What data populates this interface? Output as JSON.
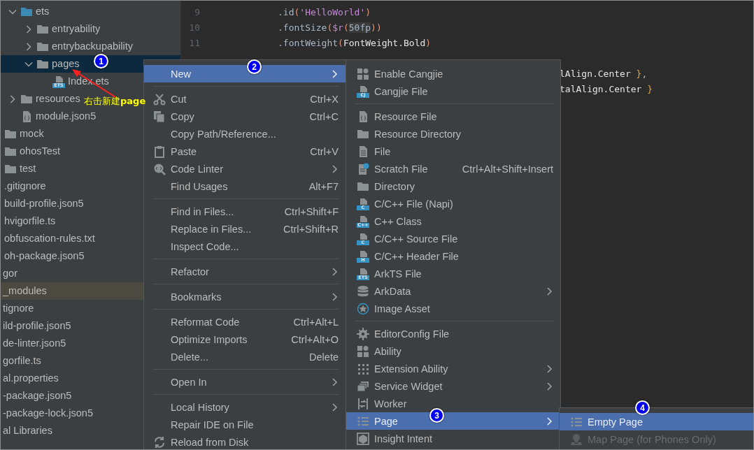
{
  "project_tree": [
    {
      "children": [
        {
          "children": [
            {
              "label": "ets",
              "kind": "source-folder",
              "expanded": true,
              "selected": false,
              "highlighted": false,
              "children": [
                {
                  "label": "entryability",
                  "kind": "folder",
                  "expanded": false,
                  "selected": false,
                  "highlighted": false
                },
                {
                  "label": "entrybackupability",
                  "kind": "folder",
                  "expanded": false,
                  "selected": false,
                  "highlighted": false
                },
                {
                  "label": "pages",
                  "kind": "folder",
                  "expanded": true,
                  "selected": true,
                  "highlighted": false,
                  "children": [
                    {
                      "label": "Index.ets",
                      "kind": "ets-file",
                      "badge": "ETS",
                      "selected": false,
                      "highlighted": false
                    }
                  ]
                }
              ]
            },
            {
              "label": "resources",
              "kind": "folder",
              "expanded": false,
              "selected": false,
              "highlighted": false
            },
            {
              "label": "module.json5",
              "kind": "json-file",
              "selected": false,
              "highlighted": false
            }
          ]
        },
        {
          "label": "mock",
          "kind": "folder",
          "selected": false,
          "highlighted": false
        },
        {
          "label": "ohosTest",
          "kind": "folder",
          "selected": false,
          "highlighted": false
        },
        {
          "label": "test",
          "kind": "folder",
          "selected": false,
          "highlighted": false
        },
        {
          "label": ".gitignore",
          "kind": "plain",
          "selected": false,
          "highlighted": false
        },
        {
          "label": "build-profile.json5",
          "kind": "plain",
          "selected": false,
          "highlighted": false
        },
        {
          "label": "hvigorfile.ts",
          "kind": "plain",
          "selected": false,
          "highlighted": false
        },
        {
          "label": "obfuscation-rules.txt",
          "kind": "plain",
          "selected": false,
          "highlighted": false
        },
        {
          "label": "oh-package.json5",
          "kind": "plain",
          "selected": false,
          "highlighted": false
        }
      ]
    },
    {
      "label": "gor",
      "kind": "plain",
      "selected": false,
      "highlighted": false
    },
    {
      "label": "_modules",
      "kind": "plain",
      "selected": false,
      "highlighted": true
    },
    {
      "label": "tignore",
      "kind": "plain",
      "selected": false,
      "highlighted": false
    },
    {
      "label": "ild-profile.json5",
      "kind": "plain",
      "selected": false,
      "highlighted": false
    },
    {
      "label": "de-linter.json5",
      "kind": "plain",
      "selected": false,
      "highlighted": false
    },
    {
      "label": "gorfile.ts",
      "kind": "plain",
      "selected": false,
      "highlighted": false
    },
    {
      "label": "al.properties",
      "kind": "plain",
      "selected": false,
      "highlighted": false
    },
    {
      "label": "-package.json5",
      "kind": "plain",
      "selected": false,
      "highlighted": false
    },
    {
      "label": "-package-lock.json5",
      "kind": "plain",
      "selected": false,
      "highlighted": false
    },
    {
      "label": "al Libraries",
      "kind": "plain",
      "selected": false,
      "highlighted": false
    }
  ],
  "editor": {
    "lines": [
      {
        "number": "9",
        "kind": "full",
        "segments": [
          {
            "text": ".id",
            "kind": "plain"
          },
          {
            "text": "(",
            "kind": "paren"
          },
          {
            "text": "'HelloWorld'",
            "kind": "string"
          },
          {
            "text": ")",
            "kind": "paren"
          }
        ]
      },
      {
        "number": "10",
        "kind": "full",
        "segments": [
          {
            "text": ".fontSize",
            "kind": "plain"
          },
          {
            "text": "(",
            "kind": "paren"
          },
          {
            "text": "$r",
            "kind": "string"
          },
          {
            "text": "(",
            "kind": "paren"
          },
          {
            "text": "50fp",
            "kind": "hint"
          },
          {
            "text": "))",
            "kind": "paren"
          }
        ]
      },
      {
        "number": "11",
        "kind": "full",
        "segments": [
          {
            "text": ".fontWeight",
            "kind": "plain"
          },
          {
            "text": "(",
            "kind": "paren"
          },
          {
            "text": "FontWeight.Bold",
            "kind": "bright"
          },
          {
            "text": ")",
            "kind": "paren"
          }
        ]
      },
      {
        "kind": "blank"
      },
      {
        "kind": "tail",
        "segments": [
          {
            "text": "lAlign.Center ",
            "kind": "bright"
          },
          {
            "text": "}",
            "kind": "brace"
          },
          {
            "text": ",",
            "kind": "plain"
          }
        ]
      },
      {
        "kind": "tail",
        "segments": [
          {
            "text": "talAlign.Center ",
            "kind": "bright"
          },
          {
            "text": "}",
            "kind": "brace"
          }
        ]
      }
    ]
  },
  "context_menu": {
    "items": [
      {
        "kind": "none",
        "label": "New",
        "submenu": true,
        "selected": true
      },
      {
        "kind": "separator"
      },
      {
        "kind": "scissors",
        "label": "Cut",
        "shortcut": "Ctrl+X",
        "submenu": false,
        "selected": false
      },
      {
        "kind": "copy",
        "label": "Copy",
        "shortcut": "Ctrl+C",
        "submenu": false,
        "selected": false
      },
      {
        "kind": "none",
        "label": "Copy Path/Reference...",
        "submenu": false,
        "selected": false
      },
      {
        "kind": "paste",
        "label": "Paste",
        "shortcut": "Ctrl+V",
        "submenu": false,
        "selected": false
      },
      {
        "kind": "linter",
        "label": "Code Linter",
        "submenu": true,
        "selected": false
      },
      {
        "kind": "none",
        "label": "Find Usages",
        "shortcut": "Alt+F7",
        "submenu": false,
        "selected": false
      },
      {
        "kind": "separator"
      },
      {
        "kind": "none",
        "label": "Find in Files...",
        "shortcut": "Ctrl+Shift+F",
        "submenu": false,
        "selected": false
      },
      {
        "kind": "none",
        "label": "Replace in Files...",
        "shortcut": "Ctrl+Shift+R",
        "submenu": false,
        "selected": false
      },
      {
        "kind": "none",
        "label": "Inspect Code...",
        "submenu": false,
        "selected": false
      },
      {
        "kind": "separator"
      },
      {
        "kind": "none",
        "label": "Refactor",
        "submenu": true,
        "selected": false
      },
      {
        "kind": "separator"
      },
      {
        "kind": "none",
        "label": "Bookmarks",
        "submenu": true,
        "selected": false
      },
      {
        "kind": "separator"
      },
      {
        "kind": "none",
        "label": "Reformat Code",
        "shortcut": "Ctrl+Alt+L",
        "submenu": false,
        "selected": false
      },
      {
        "kind": "none",
        "label": "Optimize Imports",
        "shortcut": "Ctrl+Alt+O",
        "submenu": false,
        "selected": false
      },
      {
        "kind": "none",
        "label": "Delete...",
        "shortcut": "Delete",
        "submenu": false,
        "selected": false
      },
      {
        "kind": "separator"
      },
      {
        "kind": "none",
        "label": "Open In",
        "submenu": true,
        "selected": false
      },
      {
        "kind": "separator"
      },
      {
        "kind": "none",
        "label": "Local History",
        "submenu": true,
        "selected": false
      },
      {
        "kind": "none",
        "label": "Repair IDE on File",
        "submenu": false,
        "selected": false
      },
      {
        "kind": "refresh",
        "label": "Reload from Disk",
        "submenu": false,
        "selected": false
      }
    ]
  },
  "new_submenu": {
    "items": [
      {
        "kind": "grid",
        "label": "Enable Cangjie",
        "submenu": false,
        "selected": false
      },
      {
        "kind": "badge-file",
        "badge": "CJ",
        "label": "Cangjie File",
        "submenu": false,
        "selected": false
      },
      {
        "kind": "separator"
      },
      {
        "kind": "json-file",
        "label": "Resource File",
        "submenu": false,
        "selected": false
      },
      {
        "kind": "folder",
        "label": "Resource Directory",
        "submenu": false,
        "selected": false
      },
      {
        "kind": "file",
        "label": "File",
        "submenu": false,
        "selected": false
      },
      {
        "kind": "scratch",
        "label": "Scratch File",
        "shortcut": "Ctrl+Alt+Shift+Insert",
        "submenu": false,
        "selected": false
      },
      {
        "kind": "folder",
        "label": "Directory",
        "submenu": false,
        "selected": false
      },
      {
        "kind": "c-file",
        "badge": "C",
        "label": "C/C++ File (Napi)",
        "submenu": false,
        "selected": false
      },
      {
        "kind": "badge-file",
        "badge": "C++",
        "label": "C++ Class",
        "submenu": false,
        "selected": false
      },
      {
        "kind": "badge-file",
        "badge": "C",
        "label": "C/C++ Source File",
        "submenu": false,
        "selected": false
      },
      {
        "kind": "badge-file",
        "badge": "H",
        "label": "C/C++ Header File",
        "submenu": false,
        "selected": false
      },
      {
        "kind": "badge-file",
        "badge": "ETS",
        "label": "ArkTS File",
        "submenu": false,
        "selected": false
      },
      {
        "kind": "database",
        "label": "ArkData",
        "submenu": true,
        "selected": false
      },
      {
        "kind": "star",
        "label": "Image Asset",
        "submenu": false,
        "selected": false
      },
      {
        "kind": "separator"
      },
      {
        "kind": "gear",
        "label": "EditorConfig File",
        "submenu": false,
        "selected": false
      },
      {
        "kind": "grid",
        "label": "Ability",
        "submenu": false,
        "selected": false
      },
      {
        "kind": "dots",
        "label": "Extension Ability",
        "submenu": true,
        "selected": false
      },
      {
        "kind": "windows",
        "label": "Service Widget",
        "submenu": true,
        "selected": false
      },
      {
        "kind": "worker",
        "label": "Worker",
        "submenu": false,
        "selected": false
      },
      {
        "kind": "list",
        "label": "Page",
        "submenu": true,
        "selected": true
      },
      {
        "kind": "cube",
        "label": "Insight Intent",
        "submenu": false,
        "selected": false
      }
    ]
  },
  "page_submenu": {
    "items": [
      {
        "kind": "list-dots",
        "label": "Empty Page",
        "submenu": false,
        "selected": true,
        "disabled": false
      },
      {
        "kind": "pin",
        "label": "Map Page (for Phones Only)",
        "submenu": false,
        "selected": false,
        "disabled": true
      }
    ]
  },
  "annotations": {
    "note": "右击新建**page**",
    "steps": [
      "1",
      "2",
      "3",
      "4"
    ]
  }
}
